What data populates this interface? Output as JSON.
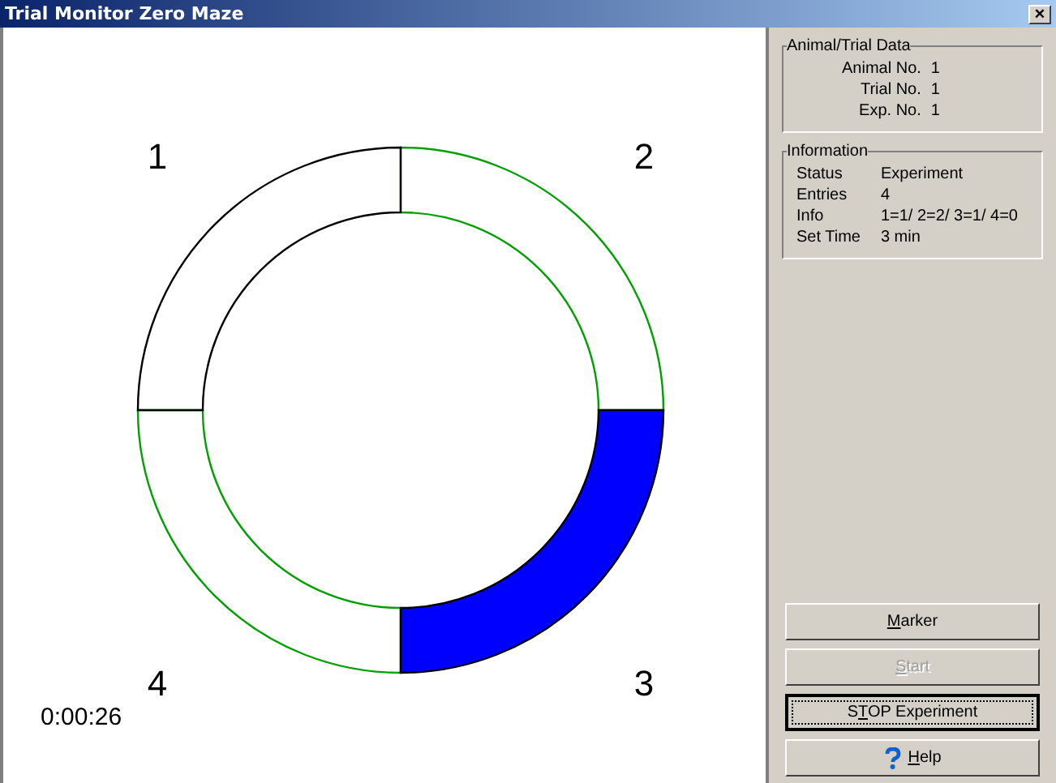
{
  "window": {
    "title": "Trial Monitor Zero Maze",
    "close": "×"
  },
  "maze": {
    "segments": [
      {
        "label": "1",
        "kind": "northwest",
        "color": "#000000",
        "selected": false
      },
      {
        "label": "2",
        "kind": "northeast",
        "color": "#00a000",
        "selected": false
      },
      {
        "label": "4",
        "kind": "southwest",
        "color": "#00a000",
        "selected": false
      },
      {
        "label": "3",
        "kind": "southeast",
        "color": "#000000",
        "selected": true
      }
    ],
    "elapsed": "0:00:26"
  },
  "animal_trial_data": {
    "title": "Animal/Trial Data",
    "rows": [
      {
        "label": "Animal No.",
        "value": "1"
      },
      {
        "label": "Trial No.",
        "value": "1"
      },
      {
        "label": "Exp. No.",
        "value": "1"
      }
    ]
  },
  "information": {
    "title": "Information",
    "rows": [
      {
        "label": "Status",
        "value": "Experiment"
      },
      {
        "label": "Entries",
        "value": "4"
      },
      {
        "label": "Info",
        "value": "1=1/ 2=2/ 3=1/ 4=0"
      },
      {
        "label": "Set Time",
        "value": "3 min"
      }
    ]
  },
  "buttons": [
    {
      "key": "M",
      "after": "arker",
      "disabled": false,
      "focused": false,
      "kind": "text"
    },
    {
      "key": "S",
      "after": "tart",
      "disabled": true,
      "focused": false,
      "kind": "text"
    },
    {
      "before": "S",
      "key": "T",
      "after": "OP Experiment",
      "disabled": false,
      "focused": true,
      "kind": "text"
    },
    {
      "key": "H",
      "after": "elp",
      "disabled": false,
      "focused": false,
      "kind": "help"
    }
  ]
}
